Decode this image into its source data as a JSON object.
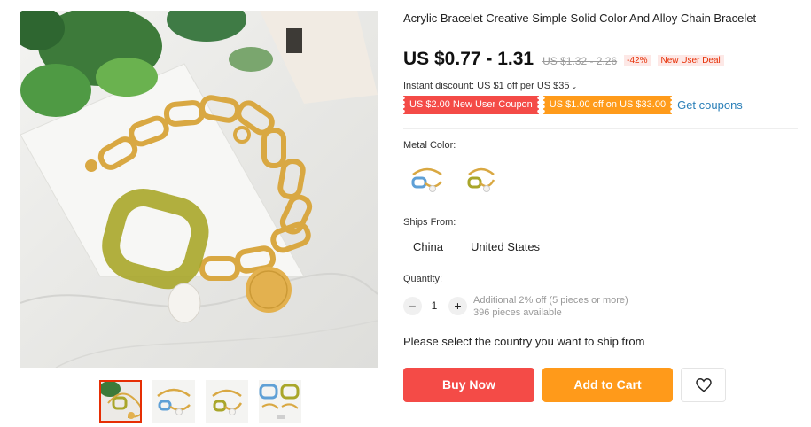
{
  "product": {
    "title": "Acrylic Bracelet Creative Simple Solid Color And Alloy Chain Bracelet",
    "price": "US $0.77 - 1.31",
    "original_price": "US $1.32 - 2.26",
    "discount": "-42%",
    "deal_badge": "New User Deal"
  },
  "discount_info": {
    "instant": "Instant discount: US $1 off per US $35",
    "coupons": [
      "US $2.00 New User Coupon",
      "US $1.00 off on US $33.00"
    ],
    "get_coupons": "Get coupons"
  },
  "metal_color": {
    "label": "Metal Color:",
    "options": [
      "blue-pendant",
      "green-pendant"
    ]
  },
  "ships_from": {
    "label": "Ships From:",
    "options": [
      "China",
      "United States"
    ]
  },
  "quantity": {
    "label": "Quantity:",
    "value": "1",
    "minus": "−",
    "plus": "+",
    "note_line1": "Additional 2% off (5 pieces or more)",
    "note_line2": "396 pieces available"
  },
  "ship_prompt": "Please select the country you want to ship from",
  "actions": {
    "buy_now": "Buy Now",
    "add_to_cart": "Add to Cart",
    "wishlist_icon": "heart-icon"
  },
  "gallery": {
    "thumbnail_count": 4,
    "active_index": 0
  },
  "colors": {
    "price_red": "#e62e04",
    "buy_red": "#f44b47",
    "cart_orange": "#ff9a1a",
    "link_blue": "#2a7fb8"
  }
}
